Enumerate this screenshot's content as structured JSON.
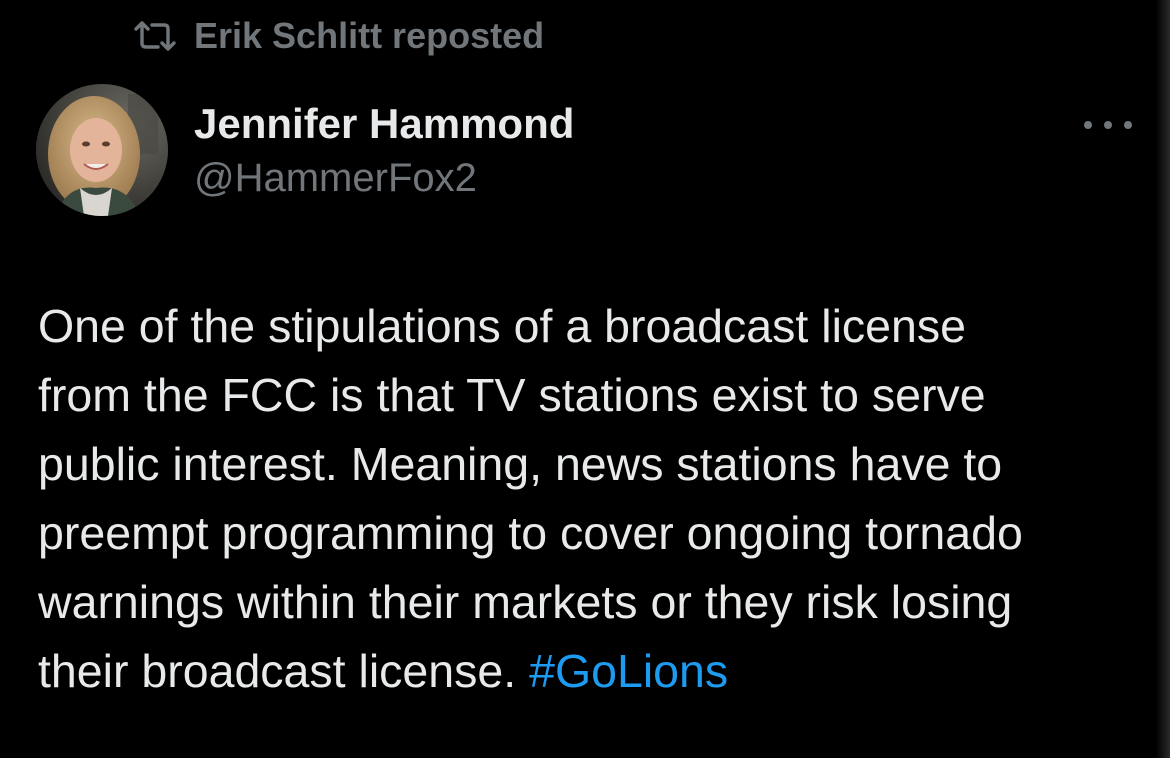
{
  "repost": {
    "label": "Erik Schlitt reposted",
    "icon": "repost-icon"
  },
  "author": {
    "name": "Jennifer Hammond",
    "handle": "@HammerFox2",
    "avatar_icon": "avatar-photo"
  },
  "more_icon": "more-dots-icon",
  "tweet": {
    "lines": [
      "One of the stipulations of a broadcast license",
      "from the FCC is that TV stations exist to serve",
      "public interest. Meaning, news stations have to",
      "preempt programming to cover ongoing tornado",
      "warnings within their markets or they risk losing"
    ],
    "last_line_text": "their broadcast license. ",
    "hashtag": "#GoLions"
  },
  "colors": {
    "background": "#000000",
    "text": "#e7e9ea",
    "muted": "#71767b",
    "link": "#1d9bf0"
  }
}
